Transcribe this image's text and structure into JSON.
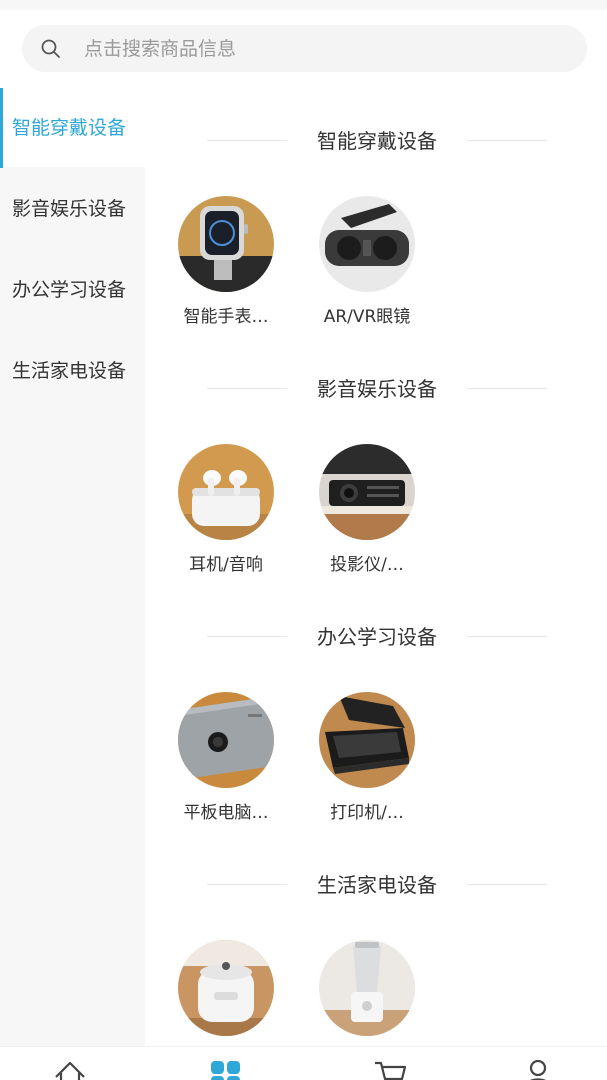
{
  "search": {
    "placeholder": "点击搜索商品信息"
  },
  "sidebar": {
    "items": [
      {
        "label": "智能穿戴设备",
        "active": true
      },
      {
        "label": "影音娱乐设备",
        "active": false
      },
      {
        "label": "办公学习设备",
        "active": false
      },
      {
        "label": "生活家电设备",
        "active": false
      }
    ]
  },
  "sections": [
    {
      "title": "智能穿戴设备",
      "items": [
        {
          "label": "智能手表…"
        },
        {
          "label": "AR/VR眼镜"
        }
      ]
    },
    {
      "title": "影音娱乐设备",
      "items": [
        {
          "label": "耳机/音响"
        },
        {
          "label": "投影仪/…"
        }
      ]
    },
    {
      "title": "办公学习设备",
      "items": [
        {
          "label": "平板电脑…"
        },
        {
          "label": "打印机/…"
        }
      ]
    },
    {
      "title": "生活家电设备",
      "items": [
        {
          "label": ""
        },
        {
          "label": ""
        }
      ]
    }
  ],
  "tabbar": {
    "icons": [
      "home-icon",
      "category-icon",
      "cart-icon",
      "user-icon"
    ]
  },
  "colors": {
    "accent": "#2fa8d8",
    "sidebar_bg": "#f7f7f7",
    "search_bg": "#f4f4f4"
  }
}
